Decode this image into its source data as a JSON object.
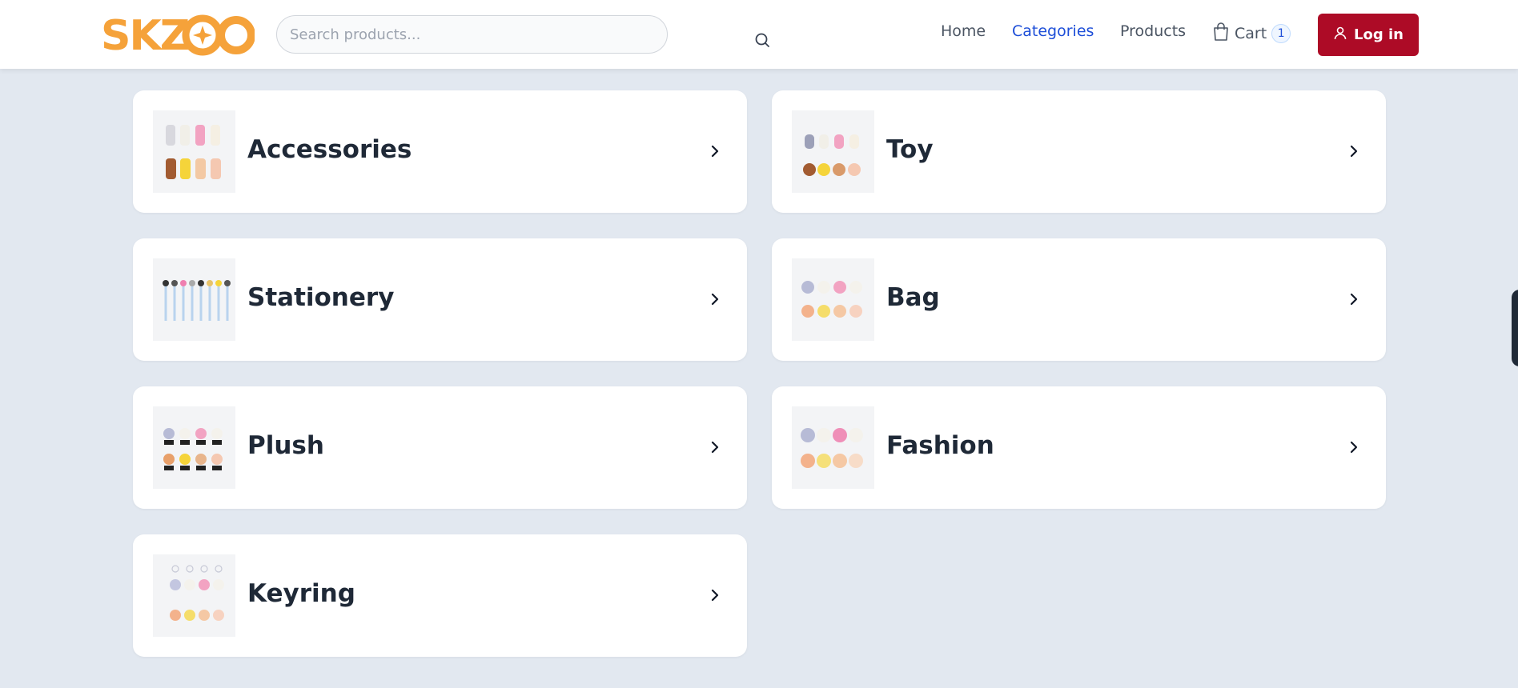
{
  "brand": {
    "logo_text": "SKZOO",
    "logo_color": "#f5a23a"
  },
  "search": {
    "placeholder": "Search products..."
  },
  "nav": {
    "home": "Home",
    "categories": "Categories",
    "products": "Products",
    "cart_label": "Cart",
    "cart_count": "1",
    "login_label": "Log in"
  },
  "colors": {
    "accent": "#1d4ed8",
    "login_bg": "#ad0b26",
    "page_bg": "#e2e8f0"
  },
  "categories": [
    {
      "name": "Accessories",
      "thumb": "accessories-thumbnail"
    },
    {
      "name": "Toy",
      "thumb": "toy-thumbnail"
    },
    {
      "name": "Stationery",
      "thumb": "stationery-thumbnail"
    },
    {
      "name": "Bag",
      "thumb": "bag-thumbnail"
    },
    {
      "name": "Plush",
      "thumb": "plush-thumbnail"
    },
    {
      "name": "Fashion",
      "thumb": "fashion-thumbnail"
    },
    {
      "name": "Keyring",
      "thumb": "keyring-thumbnail"
    }
  ]
}
